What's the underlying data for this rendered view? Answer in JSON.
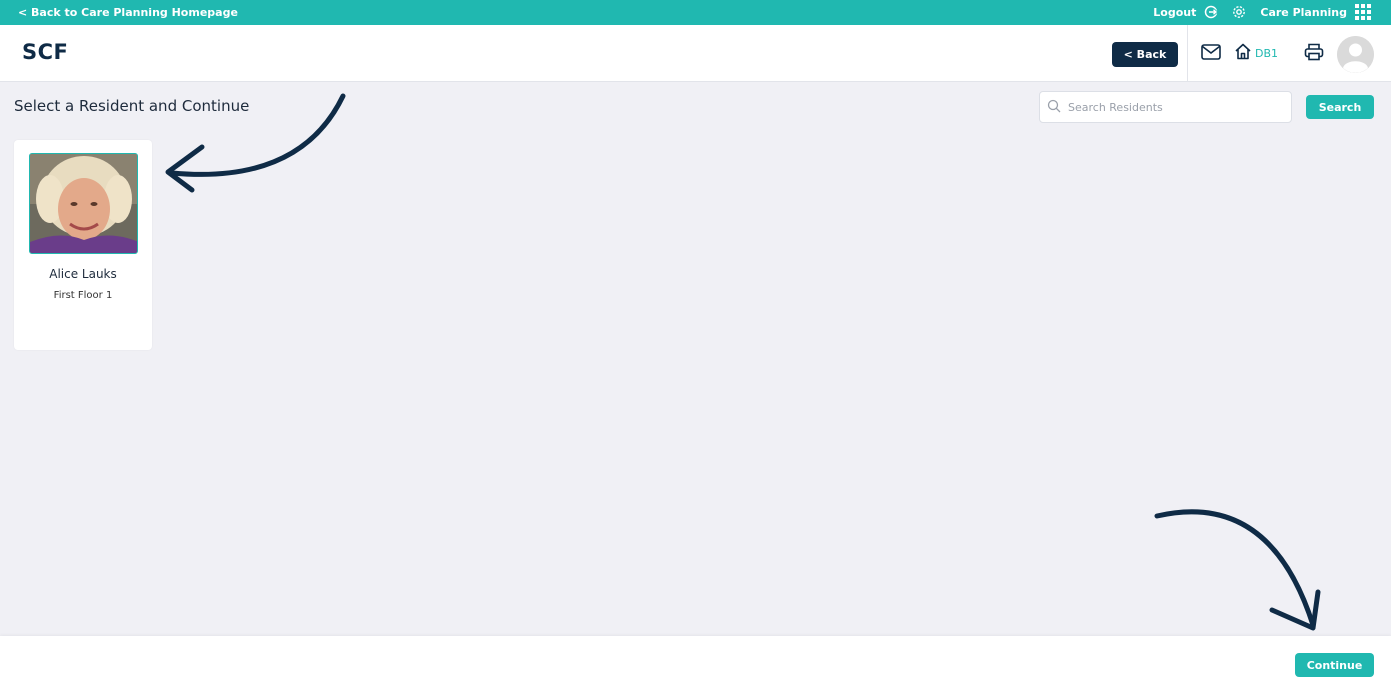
{
  "topbar": {
    "back_link": "< Back to Care Planning Homepage",
    "logout": "Logout",
    "app_name": "Care Planning"
  },
  "header": {
    "brand": "SCF",
    "back_button": "< Back",
    "home_label": "DB1"
  },
  "main": {
    "title": "Select a Resident and Continue",
    "search": {
      "placeholder": "Search Residents",
      "value": "",
      "button": "Search"
    },
    "residents": [
      {
        "name": "Alice Lauks",
        "location": "First Floor 1"
      }
    ]
  },
  "footer": {
    "continue_button": "Continue"
  },
  "colors": {
    "teal": "#20b8b0",
    "navy": "#0f2b46",
    "background": "#f0f0f5"
  }
}
